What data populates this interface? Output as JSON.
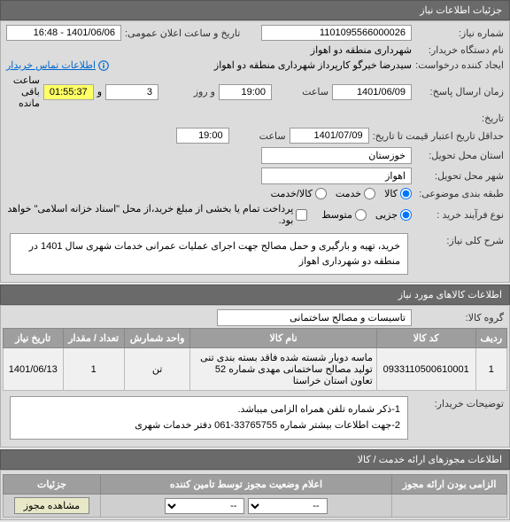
{
  "header": {
    "title": "جزئیات اطلاعات نیاز"
  },
  "fields": {
    "need_no_label": "شماره نیاز:",
    "need_no": "1101095566000026",
    "announce_label": "تاریخ و ساعت اعلان عمومی:",
    "announce_value": "1401/06/06 - 16:48",
    "buyer_org_label": "نام دستگاه خریدار:",
    "buyer_org": "شهرداری منطقه دو اهواز",
    "creator_label": "ایجاد کننده درخواست:",
    "creator": "سیدرضا خیرگو کارپرداز  شهرداری منطقه دو اهواز",
    "contact_label": "اطلاعات تماس خریدار",
    "send_date_label": "زمان ارسال پاسخ:",
    "send_date": "1401/06/09",
    "hour_label": "ساعت",
    "send_hour": "19:00",
    "until_label": "و روز",
    "until_days": "3",
    "remain_value": "01:55:37",
    "remain_label": "ساعت باقی مانده",
    "by_date_label": "تاریخ:",
    "min_validity_label": "حداقل تاریخ اعتبار قیمت تا تاریخ:",
    "min_validity_date": "1401/07/09",
    "min_validity_hour": "19:00",
    "province_label": "استان محل تحویل:",
    "province": "خوزستان",
    "city_label": "شهر محل تحویل:",
    "city": "اهواز",
    "budget_type_label": "طبقه بندی موضوعی:",
    "goods_label": "کالا",
    "service_label": "خدمت",
    "goods_service_label": "کالا/خدمت",
    "process_label": "نوع فرآیند خرید :",
    "process_all": "جزیی",
    "process_mid": "متوسط",
    "payment_note": "پرداخت تمام یا بخشی از مبلغ خرید،از محل \"اسناد خزانه اسلامی\" خواهد بود.",
    "need_desc_label": "شرح کلی نیاز:",
    "need_desc": "خرید، تهیه و بارگیری و حمل مصالح جهت اجرای عملیات عمرانی خدمات شهری سال 1401 در منطقه دو شهرداری اهواز",
    "goods_section": "اطلاعات کالاهای مورد نیاز",
    "goods_group_label": "گروه کالا:",
    "goods_group": "تاسیسات و مصالح ساختمانی",
    "buyer_notes_label": "توضیحات خریدار:",
    "buyer_notes_1": "1-ذکر شماره تلفن همراه الزامی میباشد.",
    "buyer_notes_2": "2-جهت اطلاعات بیشتر شماره 33765755-061 دفتر خدمات شهری",
    "permits_section": "اطلاعات مجوزهای ارائه خدمت / کالا",
    "mandatory_col": "الزامی بودن ارائه مجوز",
    "status_col": "اعلام وضعیت مجوز توسط تامین کننده",
    "details_col": "جزئیات",
    "view_permit_btn": "مشاهده مجوز",
    "select_placeholder": "--"
  },
  "table": {
    "headers": [
      "ردیف",
      "کد کالا",
      "نام کالا",
      "واحد شمارش",
      "تعداد / مقدار",
      "تاریخ نیاز"
    ],
    "rows": [
      {
        "idx": "1",
        "code": "0933110500610001",
        "name": "ماسه دوبار شسته شده فاقد بسته بندی تنی تولید مصالح  ساختمانی مهدی شماره 52 تعاون استان خراستا",
        "unit": "تن",
        "qty": "1",
        "date": "1401/06/13"
      }
    ]
  }
}
